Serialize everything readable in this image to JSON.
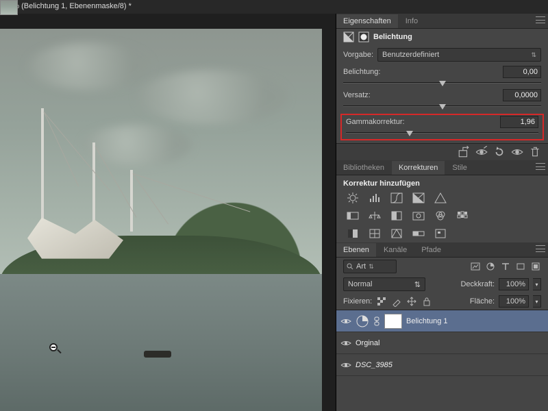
{
  "titlebar": "25% (Belichtung 1, Ebenenmaske/8) *",
  "zoom_cursor": "zoom-out",
  "properties": {
    "tabs": {
      "eigenschaften": "Eigenschaften",
      "info": "Info"
    },
    "adjustment_title": "Belichtung",
    "preset_label": "Vorgabe:",
    "preset_value": "Benutzerdefiniert",
    "exposure": {
      "label": "Belichtung:",
      "value": "0,00",
      "pos_pct": 50
    },
    "offset": {
      "label": "Versatz:",
      "value": "0,0000",
      "pos_pct": 50
    },
    "gamma": {
      "label": "Gammakorrektur:",
      "value": "1,96",
      "pos_pct": 33
    }
  },
  "adjustments_panel": {
    "tabs": {
      "bibliotheken": "Bibliotheken",
      "korrekturen": "Korrekturen",
      "stile": "Stile"
    },
    "heading": "Korrektur hinzufügen"
  },
  "layers_panel": {
    "tabs": {
      "ebenen": "Ebenen",
      "kanaele": "Kanäle",
      "pfade": "Pfade"
    },
    "filter_label": "Art",
    "blend_mode": "Normal",
    "opacity_label": "Deckkraft:",
    "opacity_value": "100%",
    "lock_label": "Fixieren:",
    "fill_label": "Fläche:",
    "fill_value": "100%",
    "layers": [
      {
        "name": "Belichtung 1",
        "type": "adjustment",
        "selected": true
      },
      {
        "name": "Orginal",
        "type": "image",
        "selected": false
      },
      {
        "name": "DSC_3985",
        "type": "image",
        "selected": false
      }
    ]
  }
}
